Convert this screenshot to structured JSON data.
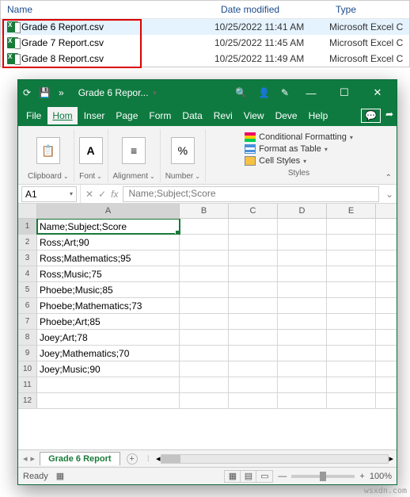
{
  "explorer": {
    "columns": {
      "name": "Name",
      "date": "Date modified",
      "type": "Type"
    },
    "rows": [
      {
        "name": "Grade 6 Report.csv",
        "date": "10/25/2022 11:41 AM",
        "type": "Microsoft Excel C..."
      },
      {
        "name": "Grade 7 Report.csv",
        "date": "10/25/2022 11:45 AM",
        "type": "Microsoft Excel C..."
      },
      {
        "name": "Grade 8 Report.csv",
        "date": "10/25/2022 11:49 AM",
        "type": "Microsoft Excel C..."
      }
    ]
  },
  "excel": {
    "title": "Grade 6 Repor...",
    "menus": {
      "file": "File",
      "home": "Hom",
      "insert": "Inser",
      "page": "Page",
      "form": "Form",
      "data": "Data",
      "review": "Revi",
      "view": "View",
      "dev": "Deve",
      "help": "Help"
    },
    "ribbon": {
      "clipboard": "Clipboard",
      "font": "Font",
      "alignment": "Alignment",
      "number": "Number",
      "styles": "Styles",
      "cond_fmt": "Conditional Formatting",
      "fmt_table": "Format as Table",
      "cell_styles": "Cell Styles"
    },
    "namebox": "A1",
    "formula": "Name;Subject;Score",
    "columns": [
      "A",
      "B",
      "C",
      "D",
      "E"
    ],
    "rows": [
      "Name;Subject;Score",
      "Ross;Art;90",
      "Ross;Mathematics;95",
      "Ross;Music;75",
      "Phoebe;Music;85",
      "Phoebe;Mathematics;73",
      "Phoebe;Art;85",
      "Joey;Art;78",
      "Joey;Mathematics;70",
      "Joey;Music;90",
      "",
      ""
    ],
    "sheet_tab": "Grade 6 Report",
    "status": {
      "ready": "Ready",
      "zoom": "100%"
    }
  },
  "watermark": "wsxdn.com"
}
